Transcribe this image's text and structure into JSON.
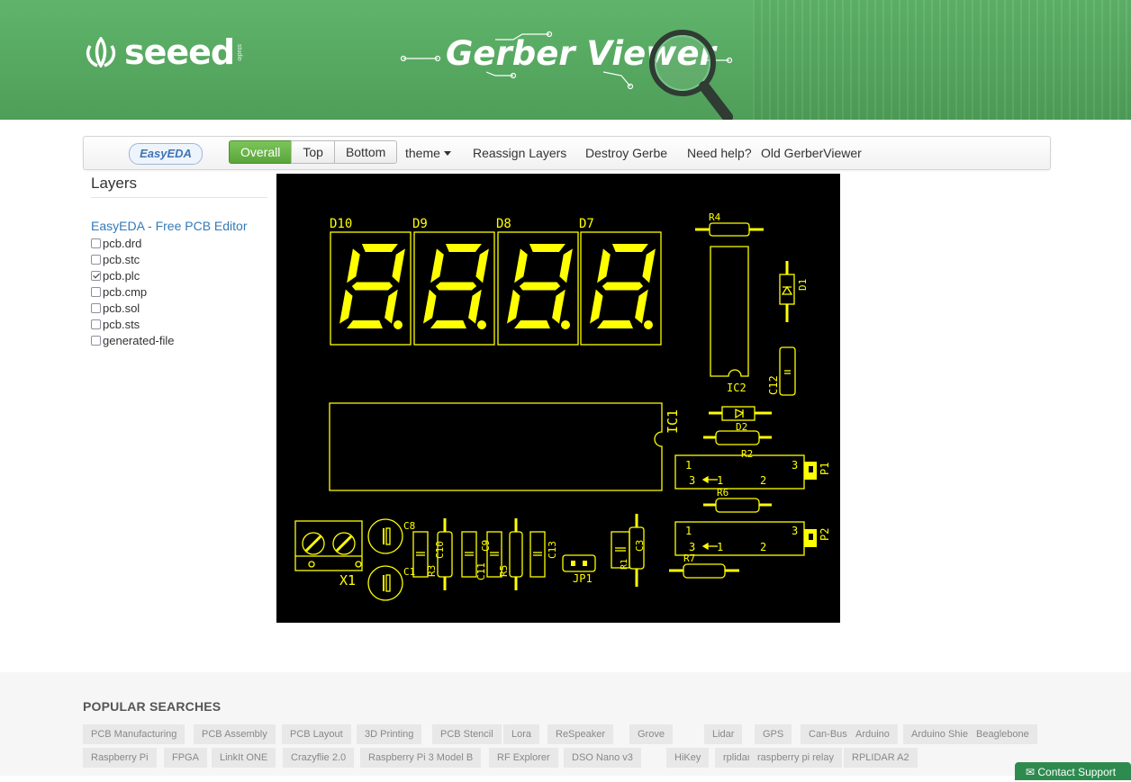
{
  "header": {
    "logo_text": "seeed",
    "logo_sub": "studio",
    "title": "Gerber Viewer"
  },
  "toolbar": {
    "easyeda_label": "EasyEDA",
    "view_buttons": [
      "Overall",
      "Top",
      "Bottom"
    ],
    "active_view": "Overall",
    "nav": {
      "theme": "theme",
      "reassign": "Reassign Layers",
      "destroy": "Destroy Gerbe",
      "help": "Need help?",
      "old": "Old GerberViewer"
    }
  },
  "layers_panel": {
    "title": "Layers",
    "editor_link": "EasyEDA - Free PCB Editor",
    "items": [
      {
        "name": "pcb.drd",
        "checked": false
      },
      {
        "name": "pcb.stc",
        "checked": false
      },
      {
        "name": "pcb.plc",
        "checked": true
      },
      {
        "name": "pcb.cmp",
        "checked": false
      },
      {
        "name": "pcb.sol",
        "checked": false
      },
      {
        "name": "pcb.sts",
        "checked": false
      },
      {
        "name": "generated-file",
        "checked": false
      }
    ]
  },
  "board": {
    "silk_color": "#ffff00",
    "background": "#000000",
    "labels": {
      "d10": "D10",
      "d9": "D9",
      "d8": "D8",
      "d7": "D7",
      "r4": "R4",
      "d1": "D1",
      "ic2": "IC2",
      "c12": "C12",
      "ic1": "IC1",
      "d2": "D2",
      "r2": "R2",
      "p1": "P1",
      "r6": "R6",
      "p2": "P2",
      "r7": "R7",
      "x1": "X1",
      "c8": "C8",
      "c1": "C1",
      "r3": "R3",
      "c10": "C10",
      "c11": "C11",
      "c9": "C9",
      "r5": "R5",
      "c13": "C13",
      "jp1": "JP1",
      "r1": "R1",
      "c3": "C3",
      "pin1": "1",
      "pin2": "2",
      "pin3": "3"
    }
  },
  "footer": {
    "title": "POPULAR SEARCHES",
    "tags_row1": [
      "PCB Manufacturing",
      "PCB Assembly",
      "PCB Layout",
      "3D Printing",
      "PCB Stencil",
      "Lora",
      "ReSpeaker",
      "Grove",
      "Lidar",
      "GPS",
      "Can-Bus",
      "Arduino",
      "Arduino Shield",
      "Beaglebone"
    ],
    "tags_row2": [
      "Raspberry Pi",
      "FPGA",
      "LinkIt ONE",
      "Crazyflie 2.0",
      "Raspberry Pi 3 Model B",
      "RF Explorer",
      "DSO Nano v3",
      "HiKey",
      "rplidar",
      "raspberry pi relay",
      "RPLIDAR A2"
    ]
  },
  "support": {
    "label": "Contact Support"
  }
}
